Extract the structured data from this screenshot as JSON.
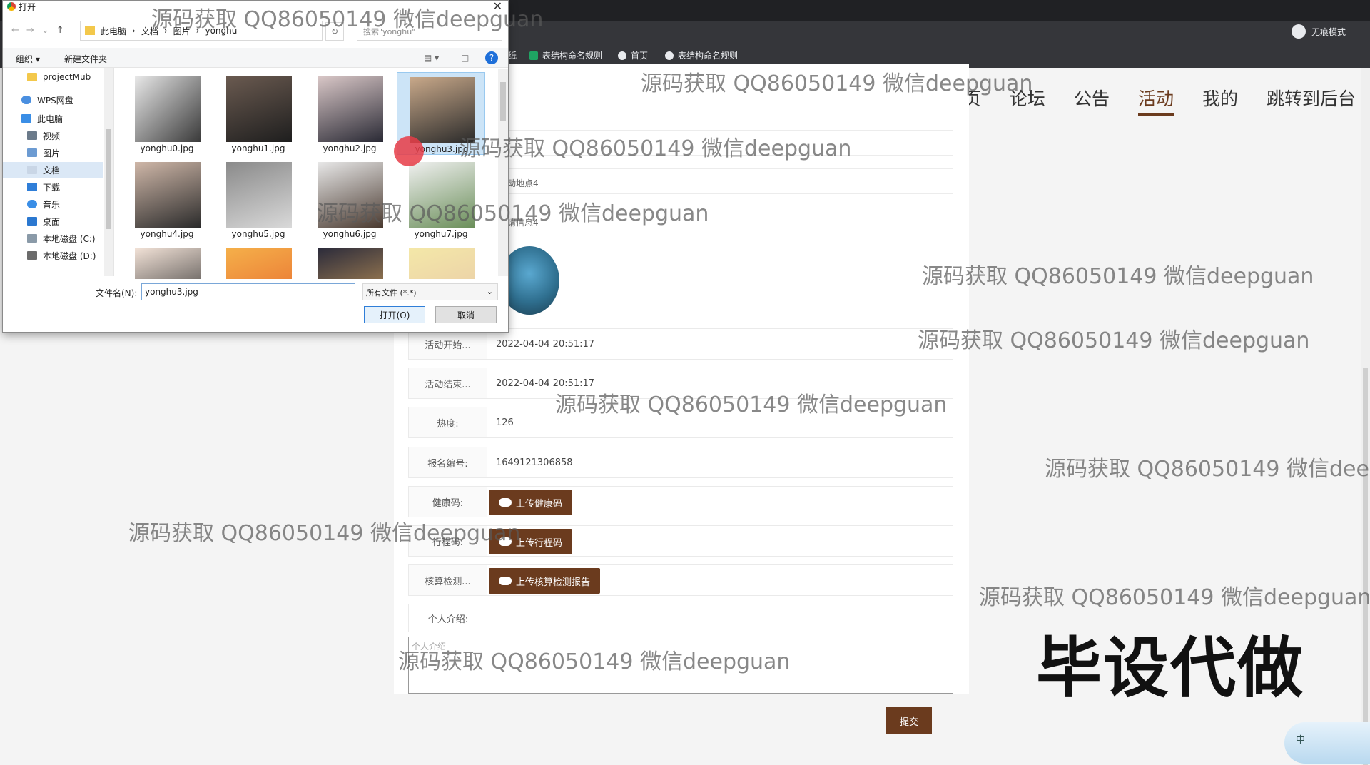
{
  "browser": {
    "incognito_label": "无痕模式",
    "bookmarks": [
      "纸",
      "表结构命名规则",
      "首页",
      "表结构命名规则"
    ]
  },
  "nav": {
    "items": [
      "首页",
      "论坛",
      "公告",
      "活动",
      "我的",
      "跳转到后台"
    ],
    "active": "活动"
  },
  "form": {
    "field_location": "动地点4",
    "field_info": "请信息4",
    "start_label": "活动开始...",
    "start_value": "2022-04-04 20:51:17",
    "end_label": "活动结束...",
    "end_value": "2022-04-04 20:51:17",
    "heat_label": "热度:",
    "heat_value": "126",
    "signup_label": "报名编号:",
    "signup_value": "1649121306858",
    "health_label": "健康码:",
    "health_btn": "上传健康码",
    "trip_label": "行程码:",
    "trip_btn": "上传行程码",
    "nucleic_label": "核算检测...",
    "nucleic_btn": "上传核算检测报告",
    "intro_label": "个人介绍:",
    "intro_placeholder": "个人介绍",
    "submit": "提交"
  },
  "dialog": {
    "title": "打开",
    "breadcrumb": [
      "此电脑",
      "文档",
      "图片",
      "yonghu"
    ],
    "search_placeholder": "搜索\"yonghu\"",
    "organize": "组织 ▾",
    "new_folder": "新建文件夹",
    "sidebar": [
      "projectMub",
      "WPS网盘",
      "此电脑",
      "视频",
      "图片",
      "文档",
      "下载",
      "音乐",
      "桌面",
      "本地磁盘 (C:)",
      "本地磁盘 (D:)"
    ],
    "sidebar_selected": "文档",
    "files": [
      "yonghu0.jpg",
      "yonghu1.jpg",
      "yonghu2.jpg",
      "yonghu3.jpg",
      "yonghu4.jpg",
      "yonghu5.jpg",
      "yonghu6.jpg",
      "yonghu7.jpg"
    ],
    "selected_file": "yonghu3.jpg",
    "filename_label": "文件名(N):",
    "filename_value": "yonghu3.jpg",
    "filetype_value": "所有文件 (*.*)",
    "open_btn": "打开(O)",
    "cancel_btn": "取消"
  },
  "watermarks": [
    "源码获取 QQ86050149 微信deepguan",
    "源码获取 QQ86050149 微信deepguan",
    "源码获取 QQ86050149 微信deepguan",
    "源码获取 QQ86050149 微信deepguan",
    "源码获取 QQ86050149 微信deepguan",
    "源码获取 QQ86050149 微信deepguan",
    "源码获取 QQ86050149 微信deepguan",
    "源码获取 QQ86050149 微信deep",
    "源码获取 QQ86050149 微信deepguan",
    "源码获取 QQ86050149 微信deepguan",
    "源码获取 QQ86050149 微信deepguan"
  ],
  "overlay_text": "毕设代做",
  "ime": "中",
  "colors": {
    "accent": "#6b3b1e",
    "chrome": "#35363a"
  }
}
